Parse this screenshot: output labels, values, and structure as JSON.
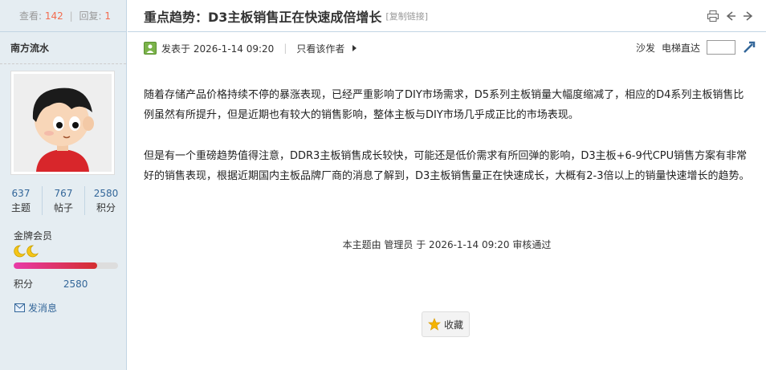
{
  "sidebar": {
    "views_label": "查看:",
    "views_value": "142",
    "replies_label": "回复:",
    "replies_value": "1",
    "author_name": "南方流水",
    "stats": [
      {
        "value": "637",
        "label": "主题"
      },
      {
        "value": "767",
        "label": "帖子"
      },
      {
        "value": "2580",
        "label": "积分"
      }
    ],
    "rank_title": "金牌会员",
    "rank_progress_percent": 80,
    "credits_label": "积分",
    "credits_value": "2580",
    "message_link": "发消息"
  },
  "thread": {
    "title": "重点趋势：D3主板销售正在快速成倍增长",
    "copy_link": "[复制链接]",
    "posted_at": "发表于 2026-1-14 09:20",
    "only_author": "只看该作者",
    "sofa": "沙发",
    "elevator": "电梯直达",
    "paragraphs": [
      "随着存储产品价格持续不停的暴涨表现，已经严重影响了DIY市场需求，D5系列主板销量大幅度缩减了，相应的D4系列主板销售比例虽然有所提升，但是近期也有较大的销售影响，整体主板与DIY市场几乎成正比的市场表现。",
      "但是有一个重磅趋势值得注意，DDR3主板销售成长较快，可能还是低价需求有所回弹的影响，D3主板+6-9代CPU销售方案有非常好的销售表现，根据近期国内主板品牌厂商的消息了解到，D3主板销售量正在快速成长，大概有2-3倍以上的销量快速增长的趋势。"
    ],
    "audit_note": "本主题由 管理员 于 2026-1-14 09:20 审核通过",
    "favorite_label": "收藏"
  },
  "colors": {
    "sidebar_bg": "#e5edf2",
    "border": "#c2d5e3",
    "link": "#336699",
    "count_highlight": "#f26c4f"
  }
}
